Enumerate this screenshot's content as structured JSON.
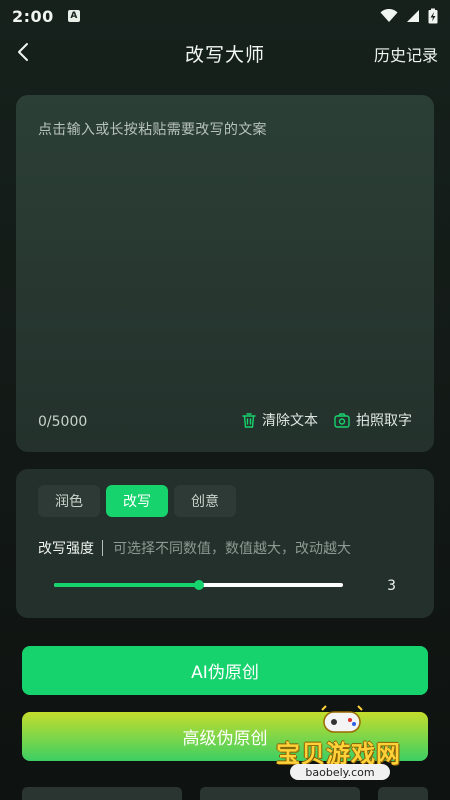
{
  "status_bar": {
    "time": "2:00",
    "a_icon": "A"
  },
  "nav": {
    "title": "改写大师",
    "history": "历史记录"
  },
  "input": {
    "placeholder": "点击输入或长按粘贴需要改写的文案",
    "char_count": "0/5000",
    "clear_label": "清除文本",
    "photo_label": "拍照取字"
  },
  "options": {
    "tabs": [
      {
        "label": "润色",
        "active": false
      },
      {
        "label": "改写",
        "active": true
      },
      {
        "label": "创意",
        "active": false
      }
    ],
    "strength_label": "改写强度",
    "strength_hint": "可选择不同数值，数值越大，改动越大",
    "strength_value": "3",
    "strength_fraction": 0.5
  },
  "buttons": {
    "ai": "AI伪原创",
    "advanced": "高级伪原创"
  },
  "watermark": {
    "text": "宝贝游戏网",
    "url": "baobely.com"
  },
  "colors": {
    "accent": "#17d36e",
    "gradient_top": "#c4dd2c",
    "gradient_bottom": "#3ccf63"
  }
}
